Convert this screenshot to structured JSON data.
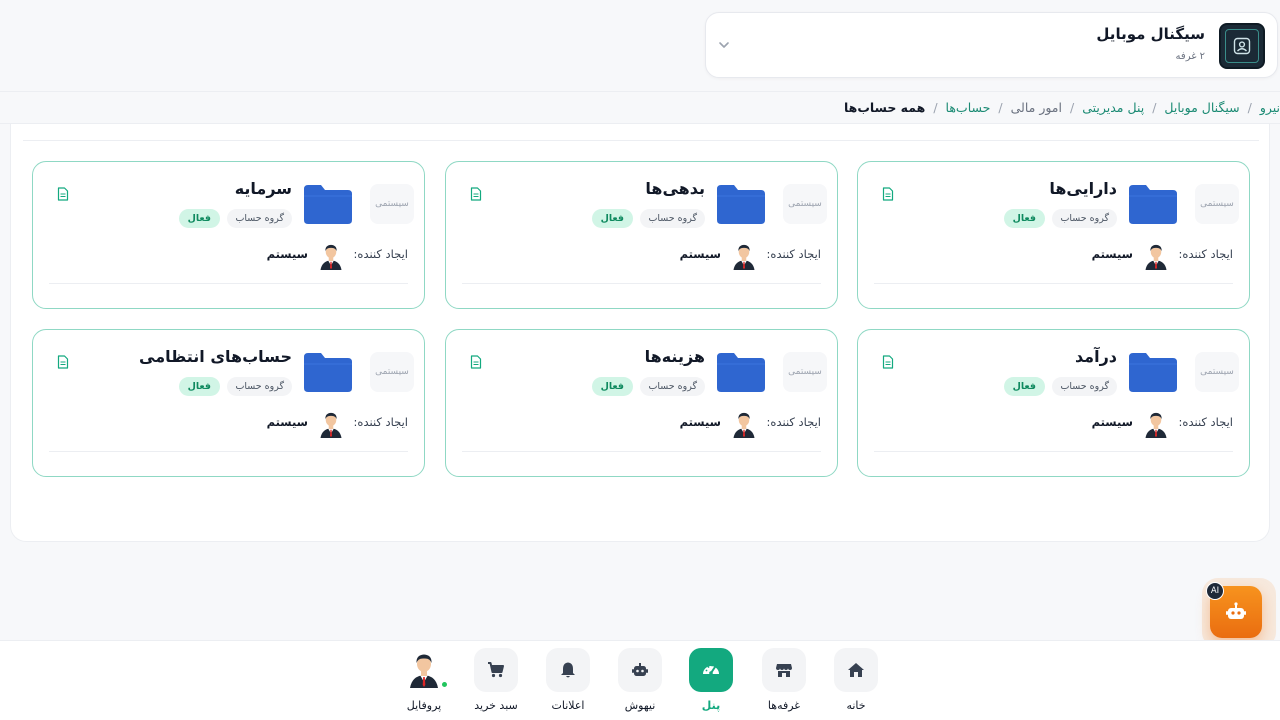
{
  "store": {
    "name": "سیگنال موبایل",
    "subtitle": "۲ غرفه"
  },
  "breadcrumb": [
    {
      "label": "نیرو",
      "kind": "link"
    },
    {
      "label": "سیگنال موبایل",
      "kind": "link"
    },
    {
      "label": "پنل مدیریتی",
      "kind": "link"
    },
    {
      "label": "امور مالی",
      "kind": "muted"
    },
    {
      "label": "حساب‌ها",
      "kind": "link"
    },
    {
      "label": "همه حساب‌ها",
      "kind": "current"
    }
  ],
  "breadcrumb_separator": "/",
  "cards": [
    {
      "title": "دارایی‌ها",
      "system_label": "سیستمی",
      "group_tag": "گروه حساب",
      "status_tag": "فعال",
      "creator_label": "ایجاد کننده:",
      "creator_name": "سیستم"
    },
    {
      "title": "بدهی‌ها",
      "system_label": "سیستمی",
      "group_tag": "گروه حساب",
      "status_tag": "فعال",
      "creator_label": "ایجاد کننده:",
      "creator_name": "سیستم"
    },
    {
      "title": "سرمایه",
      "system_label": "سیستمی",
      "group_tag": "گروه حساب",
      "status_tag": "فعال",
      "creator_label": "ایجاد کننده:",
      "creator_name": "سیستم"
    },
    {
      "title": "درآمد",
      "system_label": "سیستمی",
      "group_tag": "گروه حساب",
      "status_tag": "فعال",
      "creator_label": "ایجاد کننده:",
      "creator_name": "سیستم"
    },
    {
      "title": "هزینه‌ها",
      "system_label": "سیستمی",
      "group_tag": "گروه حساب",
      "status_tag": "فعال",
      "creator_label": "ایجاد کننده:",
      "creator_name": "سیستم"
    },
    {
      "title": "حساب‌های انتظامی",
      "system_label": "سیستمی",
      "group_tag": "گروه حساب",
      "status_tag": "فعال",
      "creator_label": "ایجاد کننده:",
      "creator_name": "سیستم"
    }
  ],
  "ai_button": {
    "badge": "AI"
  },
  "nav": {
    "home": "خانه",
    "booths": "غرفه‌ها",
    "panel": "پنل",
    "nihoosh": "نیهوش",
    "notifications": "اعلانات",
    "cart": "سبد خرید",
    "profile": "پروفایل"
  },
  "colors": {
    "accent": "#13a97f",
    "card_border": "#8fd8c4",
    "folder": "#2f66d0",
    "ai_orange": "#f7931e"
  }
}
